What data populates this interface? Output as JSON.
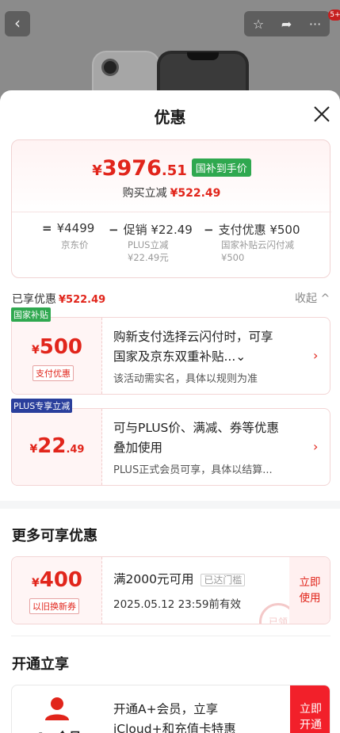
{
  "background": {
    "back_icon": "chevron-left-icon",
    "badge": "5+"
  },
  "sheet": {
    "title": "优惠"
  },
  "summary": {
    "currency": "¥",
    "price_int": "3976",
    "price_dec": ".51",
    "price_tag": "国补到手价",
    "reduce_label": "购买立减",
    "reduce_value": "¥522.49",
    "calc": [
      {
        "op": "=",
        "value": "¥4499",
        "sub": [
          "京东价"
        ]
      },
      {
        "op": "−",
        "value": "促销 ¥22.49",
        "sub": [
          "PLUS立减",
          "¥22.49元"
        ]
      },
      {
        "op": "−",
        "value": "支付优惠 ¥500",
        "sub": [
          "国家补贴云闪付减",
          "¥500"
        ]
      }
    ]
  },
  "enjoyed": {
    "label": "已享优惠",
    "value": "¥522.49",
    "collapse": "收起 ^"
  },
  "coupons": [
    {
      "corner_tag": "国家补贴",
      "corner_color": "#2fa84f",
      "currency": "¥",
      "amount": "500",
      "decimal": "",
      "mini_tag": "支付优惠",
      "desc_lines": [
        "购新支付选择云闪付时，可享",
        "国家及京东双重补贴...⌄"
      ],
      "note": "该活动需实名，具体以规则为准"
    },
    {
      "corner_tag": "PLUS专享立减",
      "corner_color": "#2a3f9c",
      "currency": "¥",
      "amount": "22",
      "decimal": ".49",
      "mini_tag": "",
      "desc_lines": [
        "可与PLUS价、满减、券等优惠",
        "叠加使用"
      ],
      "note": "PLUS正式会员可享，具体以结算..."
    }
  ],
  "more": {
    "title": "更多可享优惠",
    "coupon": {
      "currency": "¥",
      "amount": "400",
      "mini_tag": "以旧换新券",
      "condition": "满2000元可用",
      "threshold_tag": "已达门槛",
      "expiry": "2025.05.12 23:59前有效",
      "use_button": [
        "立即",
        "使用"
      ],
      "stamp": "已领"
    }
  },
  "open_section": {
    "title": "开通立享",
    "member_name": "A+会员",
    "desc_lines": [
      "开通A+会员，立享",
      "iCloud+和充值卡特惠"
    ],
    "open_button": [
      "立即",
      "开通"
    ]
  }
}
